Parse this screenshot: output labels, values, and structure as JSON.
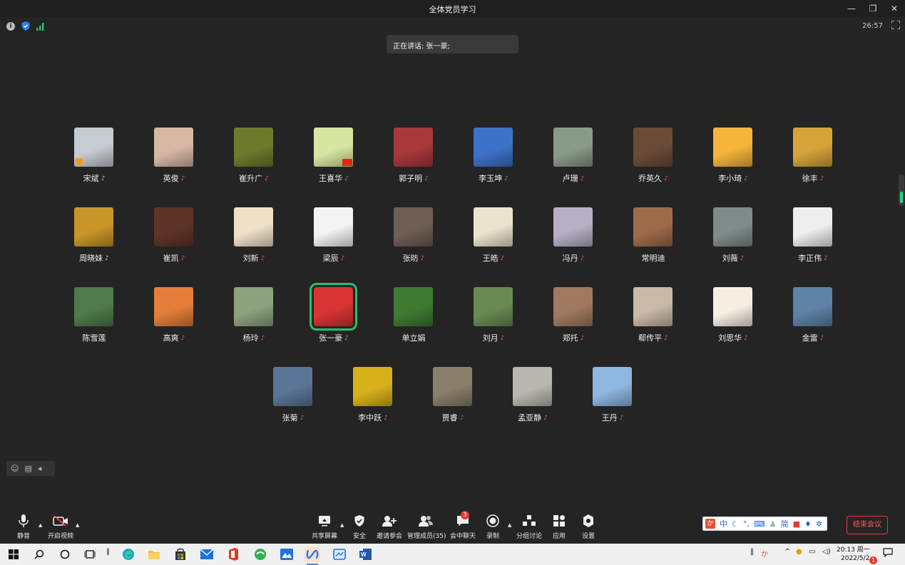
{
  "window": {
    "title": "全体党员学习",
    "minimize_glyph": "—",
    "restore_glyph": "❐",
    "close_glyph": "✕"
  },
  "meeting": {
    "timer": "26:57",
    "speaking_label": "正在讲话: 张一豪;"
  },
  "participants": [
    {
      "name": "宋斌",
      "mic": "on",
      "color": "#c7ccd2"
    },
    {
      "name": "英俊",
      "mic": "muted",
      "color": "#d7b8a5"
    },
    {
      "name": "崔升广",
      "mic": "muted",
      "color": "#6e7a2c"
    },
    {
      "name": "王喜华",
      "mic": "muted",
      "color": "#d9e6a3"
    },
    {
      "name": "郭子明",
      "mic": "muted",
      "color": "#a8383a"
    },
    {
      "name": "李玉坤",
      "mic": "muted",
      "color": "#3d72c9"
    },
    {
      "name": "卢珊",
      "mic": "muted",
      "color": "#8a9a88"
    },
    {
      "name": "乔英久",
      "mic": "muted",
      "color": "#6b4b38"
    },
    {
      "name": "李小琦",
      "mic": "muted",
      "color": "#f5b43b"
    },
    {
      "name": "徐丰",
      "mic": "muted",
      "color": "#d6a33b"
    },
    {
      "name": "周晓妹",
      "mic": "on",
      "color": "#c9962a"
    },
    {
      "name": "崔凯",
      "mic": "muted",
      "color": "#5e3428"
    },
    {
      "name": "刘新",
      "mic": "muted",
      "color": "#efe1c8"
    },
    {
      "name": "梁辰",
      "mic": "muted",
      "color": "#f3f3f3"
    },
    {
      "name": "张昉",
      "mic": "muted",
      "color": "#6e5e55"
    },
    {
      "name": "王皓",
      "mic": "muted",
      "color": "#ebe2cf"
    },
    {
      "name": "冯丹",
      "mic": "muted",
      "color": "#b7afc4"
    },
    {
      "name": "常明迪",
      "mic": "none",
      "color": "#9d6b4a"
    },
    {
      "name": "刘薇",
      "mic": "muted",
      "color": "#7f8c8a"
    },
    {
      "name": "李正伟",
      "mic": "muted",
      "color": "#eeeeee"
    },
    {
      "name": "陈雪莲",
      "mic": "none",
      "color": "#4f7a4a"
    },
    {
      "name": "高爽",
      "mic": "muted",
      "color": "#e57d3a"
    },
    {
      "name": "杨玲",
      "mic": "muted",
      "color": "#8da37f"
    },
    {
      "name": "张一豪",
      "mic": "talk",
      "color": "#d93434"
    },
    {
      "name": "单立娟",
      "mic": "none",
      "color": "#3f7a33"
    },
    {
      "name": "刘月",
      "mic": "muted",
      "color": "#6a8a54"
    },
    {
      "name": "郑托",
      "mic": "muted",
      "color": "#a07a60"
    },
    {
      "name": "郗传平",
      "mic": "muted",
      "color": "#c9b9a9"
    },
    {
      "name": "刘思华",
      "mic": "muted",
      "color": "#f7efe4"
    },
    {
      "name": "金雷",
      "mic": "muted",
      "color": "#5f82a6"
    },
    {
      "name": "张菊",
      "mic": "muted",
      "color": "#5b7596"
    },
    {
      "name": "李中跃",
      "mic": "muted",
      "color": "#d7b21c"
    },
    {
      "name": "贾睿",
      "mic": "muted",
      "color": "#8a7f68"
    },
    {
      "name": "孟亚静",
      "mic": "muted",
      "color": "#b8b8b0"
    },
    {
      "name": "王丹",
      "mic": "muted",
      "color": "#8fb7e0"
    }
  ],
  "toolbar": {
    "mute": "静音",
    "start_video": "开启视频",
    "share_screen": "共享屏幕",
    "security": "安全",
    "invite": "邀请参会",
    "manage_members": "管理成员(35)",
    "chat": "会中聊天",
    "chat_badge": "3",
    "record": "录制",
    "breakout": "分组讨论",
    "apps": "应用",
    "settings": "设置",
    "end_meeting": "结束会议"
  },
  "ime": {
    "logo": "か",
    "zh": "中",
    "simp": "简"
  },
  "taskbar": {
    "time": "20:13 周一",
    "date": "2022/5/2",
    "notif_badge": "1"
  }
}
